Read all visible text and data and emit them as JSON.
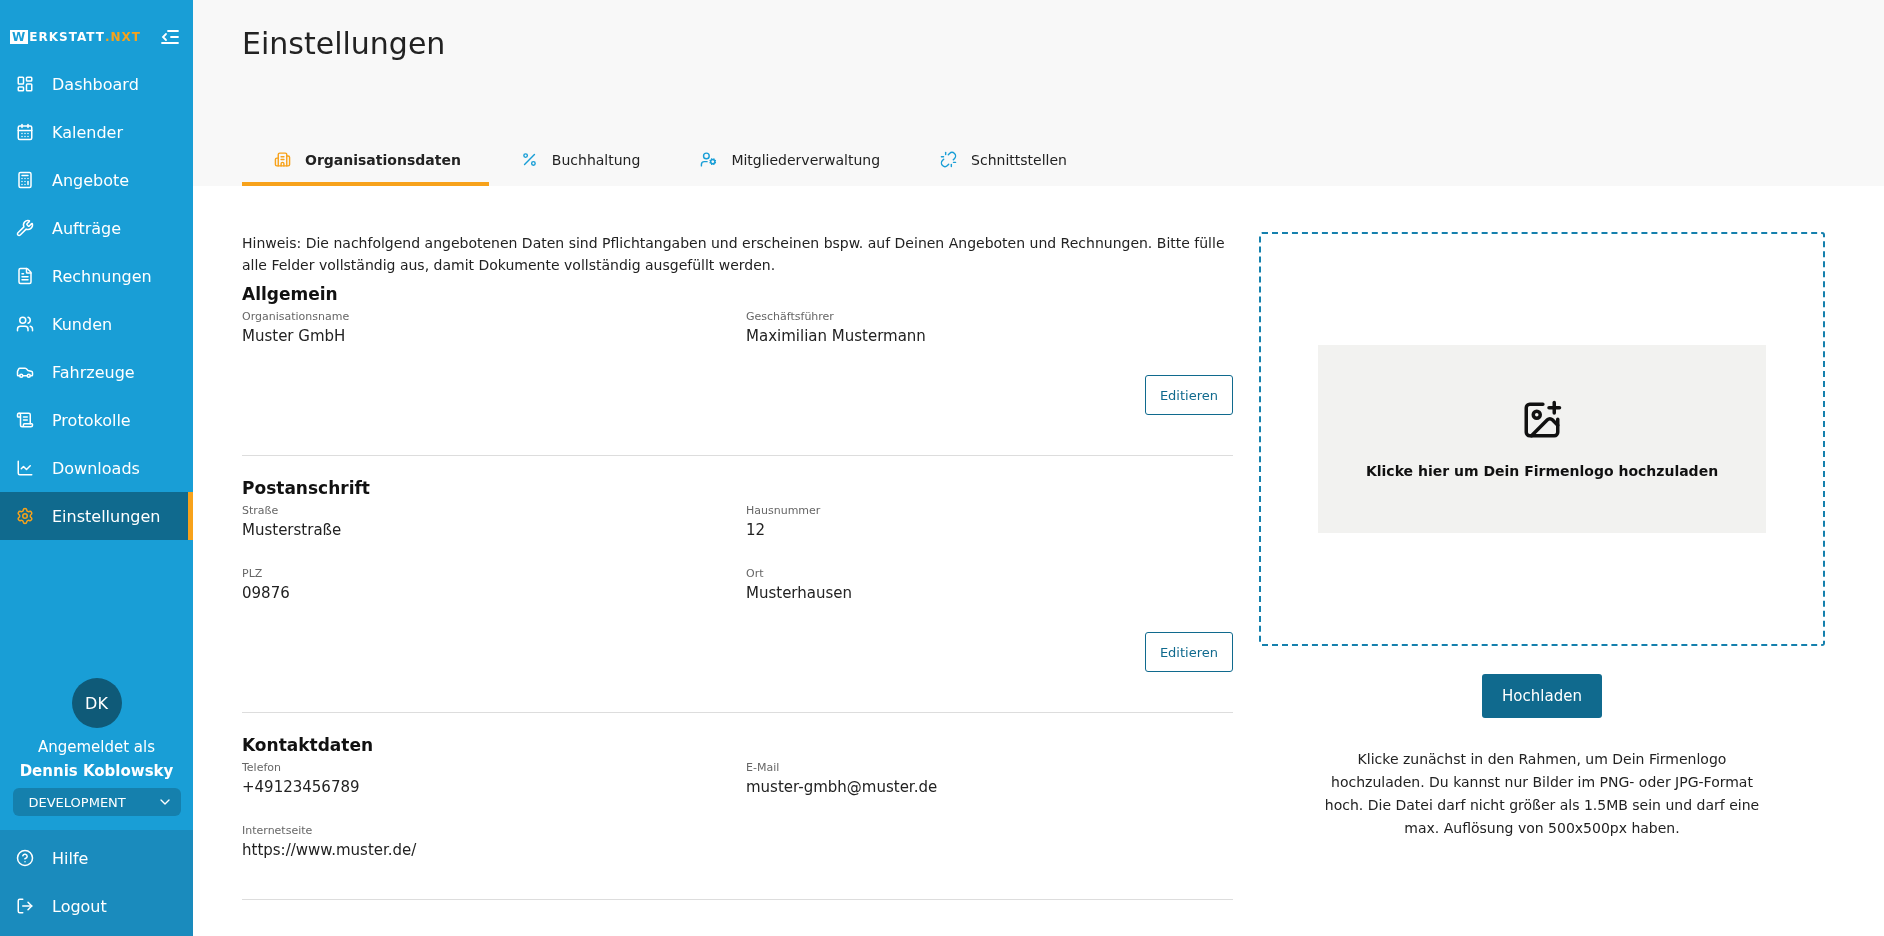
{
  "sidebar": {
    "logo": {
      "badge": "W",
      "name": "ERKSTATT",
      "suffix": ".NXT"
    },
    "items": [
      {
        "label": "Dashboard",
        "selected": false
      },
      {
        "label": "Kalender",
        "selected": false
      },
      {
        "label": "Angebote",
        "selected": false
      },
      {
        "label": "Aufträge",
        "selected": false
      },
      {
        "label": "Rechnungen",
        "selected": false
      },
      {
        "label": "Kunden",
        "selected": false
      },
      {
        "label": "Fahrzeuge",
        "selected": false
      },
      {
        "label": "Protokolle",
        "selected": false
      },
      {
        "label": "Downloads",
        "selected": false
      },
      {
        "label": "Einstellungen",
        "selected": true
      }
    ],
    "user": {
      "initials": "DK",
      "caption": "Angemeldet als",
      "name": "Dennis Koblowsky",
      "environment": "DEVELOPMENT"
    },
    "footer_items": [
      {
        "label": "Hilfe"
      },
      {
        "label": "Logout"
      }
    ]
  },
  "page": {
    "title": "Einstellungen",
    "tabs": [
      {
        "label": "Organisationsdaten",
        "selected": true
      },
      {
        "label": "Buchhaltung",
        "selected": false
      },
      {
        "label": "Mitgliederverwaltung",
        "selected": false
      },
      {
        "label": "Schnittstellen",
        "selected": false
      }
    ],
    "notice": "Hinweis: Die nachfolgend angebotenen Daten sind Pflichtangaben und erscheinen bspw. auf Deinen Angeboten und Rechnungen. Bitte fülle alle Felder vollständig aus, damit Dokumente vollständig ausgefüllt werden.",
    "sections": [
      {
        "title": "Allgemein",
        "fields": [
          {
            "label": "Organisationsname",
            "value": "Muster GmbH"
          },
          {
            "label": "Geschäftsführer",
            "value": "Maximilian Mustermann"
          }
        ],
        "button": "Editieren"
      },
      {
        "title": "Postanschrift",
        "fields": [
          {
            "label": "Straße",
            "value": "Musterstraße"
          },
          {
            "label": "Hausnummer",
            "value": "12"
          },
          {
            "label": "PLZ",
            "value": "09876"
          },
          {
            "label": "Ort",
            "value": "Musterhausen"
          }
        ],
        "button": "Editieren"
      },
      {
        "title": "Kontaktdaten",
        "fields": [
          {
            "label": "Telefon",
            "value": "+49123456789"
          },
          {
            "label": "E-Mail",
            "value": "muster-gmbh@muster.de"
          },
          {
            "label": "Internetseite",
            "value": "https://www.muster.de/"
          }
        ]
      }
    ],
    "logo_upload": {
      "prompt": "Klicke hier um Dein Firmenlogo hochzuladen",
      "button": "Hochladen",
      "help": "Klicke zunächst in den Rahmen, um Dein Firmenlogo hochzuladen. Du kannst nur Bilder im PNG- oder JPG-Format hoch. Die Datei darf nicht größer als 1.5MB sein und darf eine max. Auflösung von 500x500px haben."
    }
  }
}
